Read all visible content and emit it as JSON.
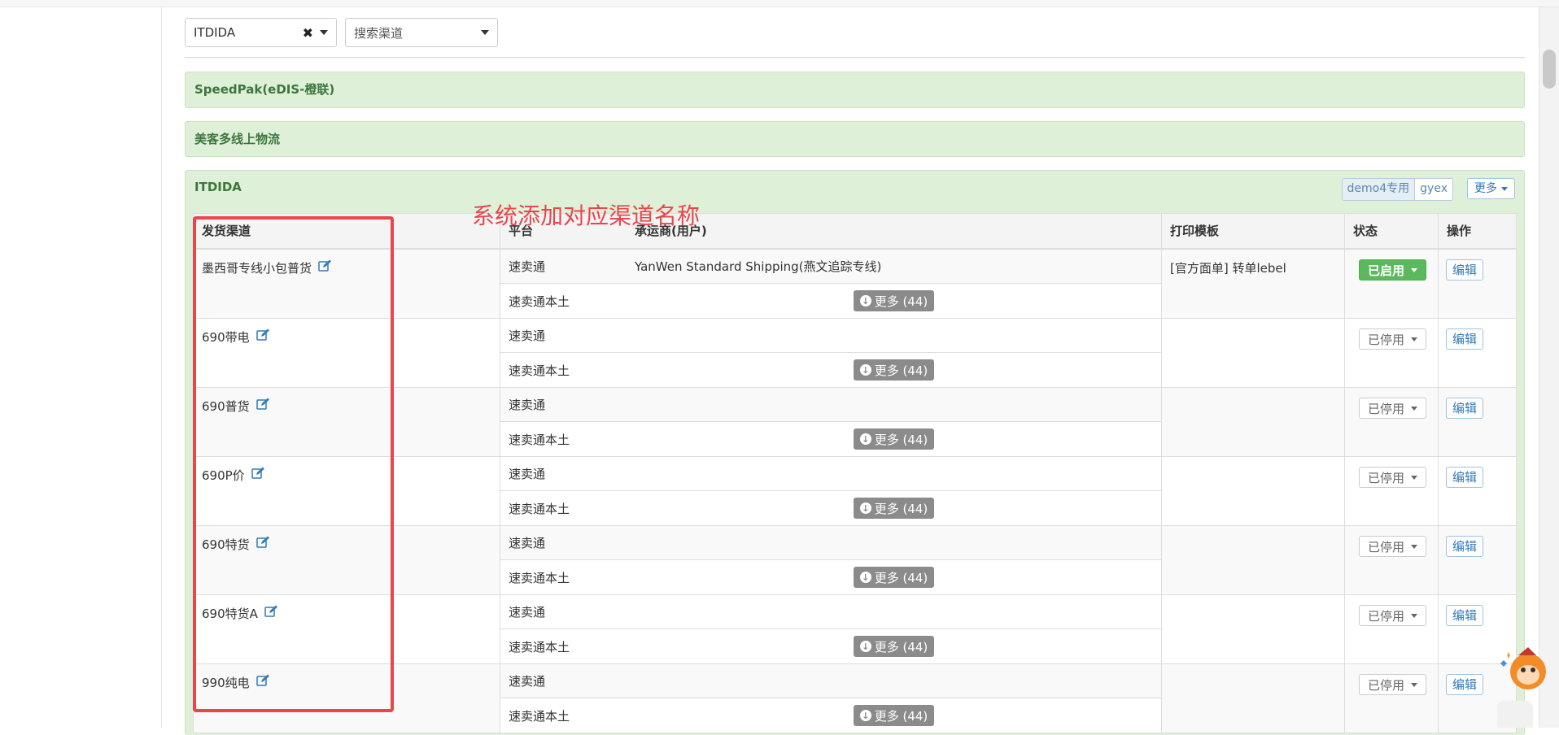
{
  "filters": {
    "carrier": "ITDIDA",
    "channel_search": "搜索渠道"
  },
  "groups": [
    {
      "title": "SpeedPak(eDIS-橙联)"
    },
    {
      "title": "美客多线上物流"
    }
  ],
  "active_group": {
    "title": "ITDIDA",
    "tags": [
      "demo4专用",
      "gyex"
    ],
    "more_label": "更多"
  },
  "table": {
    "headers": {
      "channel": "发货渠道",
      "platform": "平台",
      "carrier": "承运商(用户)",
      "template": "打印模板",
      "status": "状态",
      "action": "操作"
    },
    "rows": [
      {
        "name": "墨西哥专线小包普货",
        "p1": "速卖通",
        "c1": "YanWen Standard Shipping(燕文追踪专线)",
        "p2": "速卖通本土",
        "c2": "更多 (44)",
        "template": "[官方面单] 转单lebel",
        "status": "已启用",
        "action": "编辑"
      },
      {
        "name": "690带电",
        "p1": "速卖通",
        "c1": "",
        "p2": "速卖通本土",
        "c2": "更多 (44)",
        "template": "",
        "status": "已停用",
        "action": "编辑"
      },
      {
        "name": "690普货",
        "p1": "速卖通",
        "c1": "",
        "p2": "速卖通本土",
        "c2": "更多 (44)",
        "template": "",
        "status": "已停用",
        "action": "编辑"
      },
      {
        "name": "690P价",
        "p1": "速卖通",
        "c1": "",
        "p2": "速卖通本土",
        "c2": "更多 (44)",
        "template": "",
        "status": "已停用",
        "action": "编辑"
      },
      {
        "name": "690特货",
        "p1": "速卖通",
        "c1": "",
        "p2": "速卖通本土",
        "c2": "更多 (44)",
        "template": "",
        "status": "已停用",
        "action": "编辑"
      },
      {
        "name": "690特货A",
        "p1": "速卖通",
        "c1": "",
        "p2": "速卖通本土",
        "c2": "更多 (44)",
        "template": "",
        "status": "已停用",
        "action": "编辑"
      },
      {
        "name": "990纯电",
        "p1": "速卖通",
        "c1": "",
        "p2": "速卖通本土",
        "c2": "更多 (44)",
        "template": "",
        "status": "已停用",
        "action": "编辑"
      }
    ]
  },
  "annotation": "系统添加对应渠道名称",
  "colors": {
    "panel_bg": "#dff0d8",
    "panel_text": "#3c763d",
    "enabled_green": "#5cb85c",
    "highlight_red": "#e8464b",
    "link_blue": "#337ab7"
  }
}
